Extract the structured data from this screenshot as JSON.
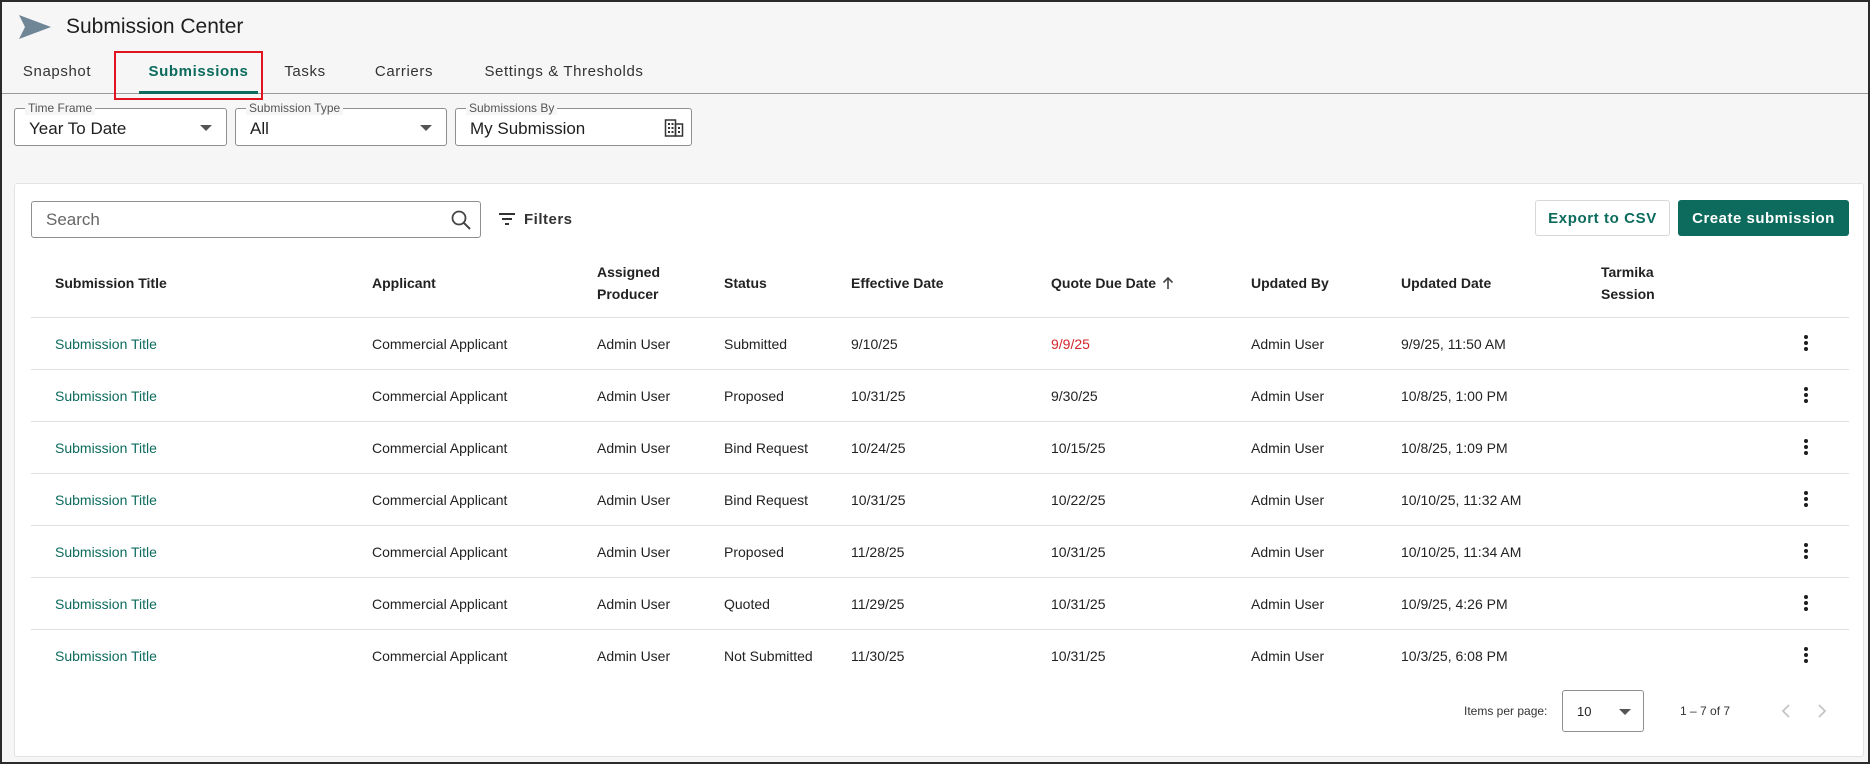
{
  "app": {
    "title": "Submission Center"
  },
  "tabs": [
    {
      "label": "Snapshot",
      "active": false
    },
    {
      "label": "Submissions",
      "active": true
    },
    {
      "label": "Tasks",
      "active": false
    },
    {
      "label": "Carriers",
      "active": false
    },
    {
      "label": "Settings & Thresholds",
      "active": false
    }
  ],
  "filters": {
    "time_frame": {
      "label": "Time Frame",
      "value": "Year To Date"
    },
    "submission_type": {
      "label": "Submission Type",
      "value": "All"
    },
    "submissions_by": {
      "label": "Submissions By",
      "value": "My Submission"
    }
  },
  "toolbar": {
    "search_placeholder": "Search",
    "filters_label": "Filters",
    "export_label": "Export to CSV",
    "create_label": "Create submission"
  },
  "table": {
    "columns": {
      "title": "Submission Title",
      "applicant": "Applicant",
      "producer_line1": "Assigned",
      "producer_line2": "Producer",
      "status": "Status",
      "effective": "Effective Date",
      "quote_due": "Quote Due Date",
      "updated_by": "Updated By",
      "updated_date": "Updated Date",
      "tarmika_line1": "Tarmika",
      "tarmika_line2": "Session"
    },
    "sort": {
      "column": "Quote Due Date",
      "direction": "ascending"
    },
    "rows": [
      {
        "title": "Submission Title",
        "applicant": "Commercial Applicant",
        "producer": "Admin User",
        "status": "Submitted",
        "effective": "9/10/25",
        "quote_due": "9/9/25",
        "quote_due_overdue": true,
        "updated_by": "Admin User",
        "updated_date": "9/9/25, 11:50 AM",
        "tarmika": ""
      },
      {
        "title": "Submission Title",
        "applicant": "Commercial Applicant",
        "producer": "Admin User",
        "status": "Proposed",
        "effective": "10/31/25",
        "quote_due": "9/30/25",
        "quote_due_overdue": false,
        "updated_by": "Admin User",
        "updated_date": "10/8/25, 1:00 PM",
        "tarmika": ""
      },
      {
        "title": "Submission Title",
        "applicant": "Commercial Applicant",
        "producer": "Admin User",
        "status": "Bind Request",
        "effective": "10/24/25",
        "quote_due": "10/15/25",
        "quote_due_overdue": false,
        "updated_by": "Admin User",
        "updated_date": "10/8/25, 1:09 PM",
        "tarmika": ""
      },
      {
        "title": "Submission Title",
        "applicant": "Commercial Applicant",
        "producer": "Admin User",
        "status": "Bind Request",
        "effective": "10/31/25",
        "quote_due": "10/22/25",
        "quote_due_overdue": false,
        "updated_by": "Admin User",
        "updated_date": "10/10/25, 11:32 AM",
        "tarmika": ""
      },
      {
        "title": "Submission Title",
        "applicant": "Commercial Applicant",
        "producer": "Admin User",
        "status": "Proposed",
        "effective": "11/28/25",
        "quote_due": "10/31/25",
        "quote_due_overdue": false,
        "updated_by": "Admin User",
        "updated_date": "10/10/25, 11:34 AM",
        "tarmika": ""
      },
      {
        "title": "Submission Title",
        "applicant": "Commercial Applicant",
        "producer": "Admin User",
        "status": "Quoted",
        "effective": "11/29/25",
        "quote_due": "10/31/25",
        "quote_due_overdue": false,
        "updated_by": "Admin User",
        "updated_date": "10/9/25, 4:26 PM",
        "tarmika": ""
      },
      {
        "title": "Submission Title",
        "applicant": "Commercial Applicant",
        "producer": "Admin User",
        "status": "Not Submitted",
        "effective": "11/30/25",
        "quote_due": "10/31/25",
        "quote_due_overdue": false,
        "updated_by": "Admin User",
        "updated_date": "10/3/25, 6:08 PM",
        "tarmika": ""
      }
    ]
  },
  "pagination": {
    "items_per_page_label": "Items per page:",
    "items_per_page": "10",
    "range": "1 – 7 of 7"
  },
  "colors": {
    "accent": "#0c6b5d",
    "overdue": "#d3262d",
    "highlight": "#e0141e"
  },
  "icons": {
    "logo": "paper-plane-icon",
    "time_frame_caret": "chevron-down-icon",
    "submission_type_caret": "chevron-down-icon",
    "submissions_by": "building-icon",
    "search": "search-icon",
    "filters": "filter-icon",
    "sort": "arrow-up-icon",
    "row_menu": "more-vert-icon",
    "prev": "chevron-left-icon",
    "next": "chevron-right-icon"
  }
}
